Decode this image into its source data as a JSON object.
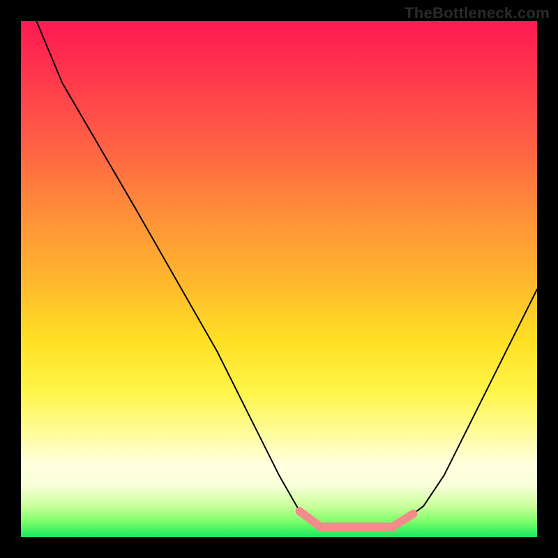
{
  "watermark": "TheBottleneck.com",
  "chart_data": {
    "type": "line",
    "title": "",
    "xlabel": "",
    "ylabel": "",
    "xlim": [
      0,
      100
    ],
    "ylim": [
      0,
      100
    ],
    "x": [
      3,
      8,
      15,
      22,
      30,
      38,
      44,
      50,
      54,
      56,
      58,
      62,
      66,
      70,
      72,
      74,
      78,
      82,
      86,
      90,
      94,
      98,
      100
    ],
    "values": [
      100,
      88,
      76,
      64,
      50,
      36,
      24,
      12,
      5,
      3,
      2,
      1.5,
      1.5,
      1.5,
      2,
      3,
      6,
      12,
      20,
      28,
      36,
      44,
      48
    ],
    "highlight_segments": [
      {
        "x_from": 54,
        "x_to": 58,
        "slope": "down",
        "color": "#f48b8b"
      },
      {
        "x_from": 58,
        "x_to": 72,
        "slope": "flat",
        "color": "#f48b8b"
      },
      {
        "x_from": 72,
        "x_to": 76,
        "slope": "up",
        "color": "#f48b8b"
      }
    ],
    "gradient_stops": [
      {
        "pct": 0,
        "color": "#ff1a53"
      },
      {
        "pct": 50,
        "color": "#ffb62e"
      },
      {
        "pct": 72,
        "color": "#fff54a"
      },
      {
        "pct": 100,
        "color": "#17e85e"
      }
    ]
  }
}
